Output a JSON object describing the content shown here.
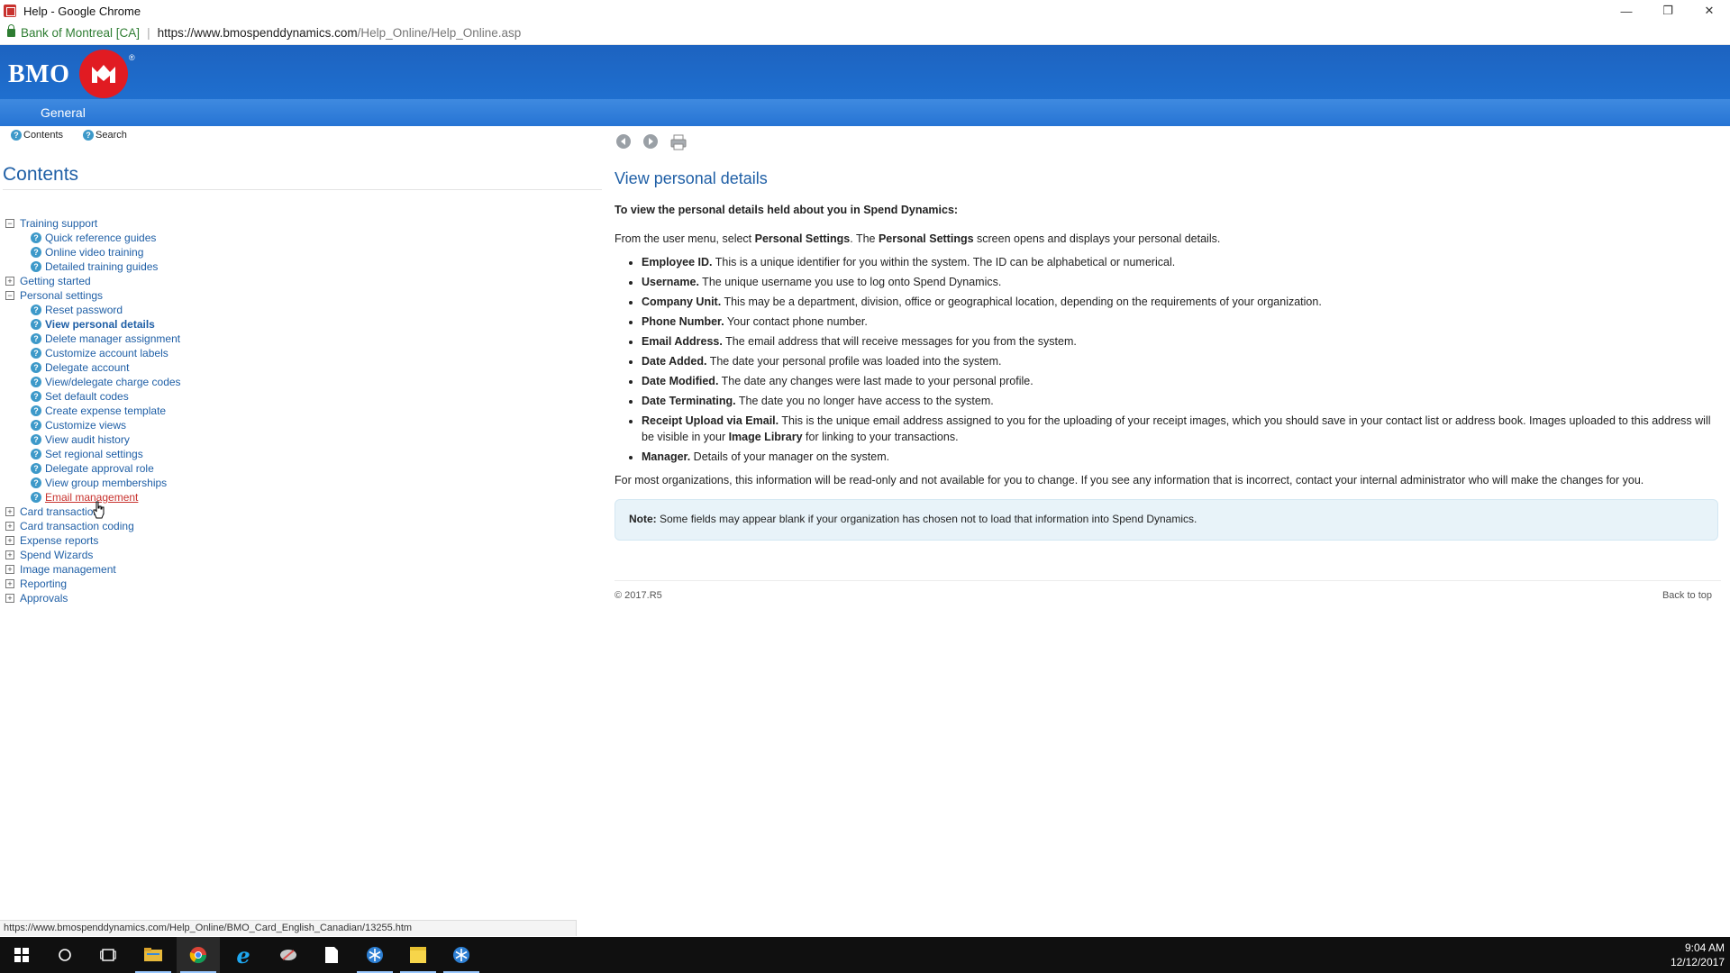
{
  "window": {
    "title": "Help - Google Chrome"
  },
  "address": {
    "site_id": "Bank of Montreal [CA]",
    "separator": "|",
    "url_host": "https://www.bmospenddynamics.com",
    "url_path": "/Help_Online/Help_Online.asp"
  },
  "brand": {
    "name": "BMO",
    "reg": "®",
    "section": "General"
  },
  "left": {
    "tabs": [
      "Contents",
      "Search"
    ],
    "title": "Contents",
    "toc": [
      {
        "label": "Training support",
        "level": 0,
        "exp": "−"
      },
      {
        "label": "Quick reference guides",
        "level": 1
      },
      {
        "label": "Online video training",
        "level": 1
      },
      {
        "label": "Detailed training guides",
        "level": 1
      },
      {
        "label": "Getting started",
        "level": 0,
        "exp": "+"
      },
      {
        "label": "Personal settings",
        "level": 0,
        "exp": "−"
      },
      {
        "label": "Reset password",
        "level": 1
      },
      {
        "label": "View personal details",
        "level": 1,
        "state": "active"
      },
      {
        "label": "Delete manager assignment",
        "level": 1
      },
      {
        "label": "Customize account labels",
        "level": 1
      },
      {
        "label": "Delegate account",
        "level": 1
      },
      {
        "label": "View/delegate charge codes",
        "level": 1
      },
      {
        "label": "Set default codes",
        "level": 1
      },
      {
        "label": "Create expense template",
        "level": 1
      },
      {
        "label": "Customize views",
        "level": 1
      },
      {
        "label": "View audit history",
        "level": 1
      },
      {
        "label": "Set regional settings",
        "level": 1
      },
      {
        "label": "Delegate approval role",
        "level": 1
      },
      {
        "label": "View group memberships",
        "level": 1
      },
      {
        "label": "Email management",
        "level": 1,
        "state": "hover"
      },
      {
        "label": "Card transactions",
        "level": 0,
        "exp": "+"
      },
      {
        "label": "Card transaction coding",
        "level": 0,
        "exp": "+"
      },
      {
        "label": "Expense reports",
        "level": 0,
        "exp": "+"
      },
      {
        "label": "Spend Wizards",
        "level": 0,
        "exp": "+"
      },
      {
        "label": "Image management",
        "level": 0,
        "exp": "+"
      },
      {
        "label": "Reporting",
        "level": 0,
        "exp": "+"
      },
      {
        "label": "Approvals",
        "level": 0,
        "exp": "+"
      }
    ],
    "status_url": "https://www.bmospenddynamics.com/Help_Online/BMO_Card_English_Canadian/13255.htm"
  },
  "help": {
    "title": "View personal details",
    "intro": "To view the personal details held about you in Spend Dynamics:",
    "lead": {
      "p1": "From the user menu, select ",
      "b1": "Personal Settings",
      "p2": ". The ",
      "b2": "Personal Settings",
      "p3": " screen opens and displays your personal details."
    },
    "fields": [
      {
        "term": "Employee ID.",
        "desc": " This is a unique identifier for you within the system. The ID can be alphabetical or numerical."
      },
      {
        "term": "Username.",
        "desc": " The unique username you use to log onto Spend Dynamics."
      },
      {
        "term": "Company Unit.",
        "desc": " This may be a department, division, office or geographical location, depending on the requirements of your organization."
      },
      {
        "term": "Phone Number.",
        "desc": " Your contact phone number."
      },
      {
        "term": "Email Address.",
        "desc": " The email address that will receive messages for you from the system."
      },
      {
        "term": "Date Added.",
        "desc": " The date your personal profile was loaded into the system."
      },
      {
        "term": "Date Modified.",
        "desc": " The date any changes were last made to your personal profile."
      },
      {
        "term": "Date Terminating.",
        "desc": " The date you no longer have access to the system."
      },
      {
        "term": "Receipt Upload via Email.",
        "desc": " This is the unique email address assigned to you for the uploading of your receipt images, which you should save in your contact list or address book. Images uploaded to this address will be visible in your ",
        "bold2": "Image Library",
        "desc2": " for linking to your transactions."
      },
      {
        "term": "Manager.",
        "desc": " Details of your manager on the system."
      }
    ],
    "closing": "For most organizations, this information will be read-only and not available for you to change. If you see any information that is incorrect, contact your internal administrator who will make the changes for you.",
    "note_label": "Note:",
    "note_text": " Some fields may appear blank if your organization has chosen not to load that information into Spend Dynamics.",
    "copyright": "© 2017.R5",
    "back_to_top": "Back to top"
  },
  "taskbar": {
    "time": "9:04 AM",
    "date": "12/12/2017"
  },
  "colors": {
    "brand_blue": "#1f6fcf",
    "brand_red": "#e11b22",
    "link": "#1f5fa6",
    "hover_link": "#c8322e"
  }
}
